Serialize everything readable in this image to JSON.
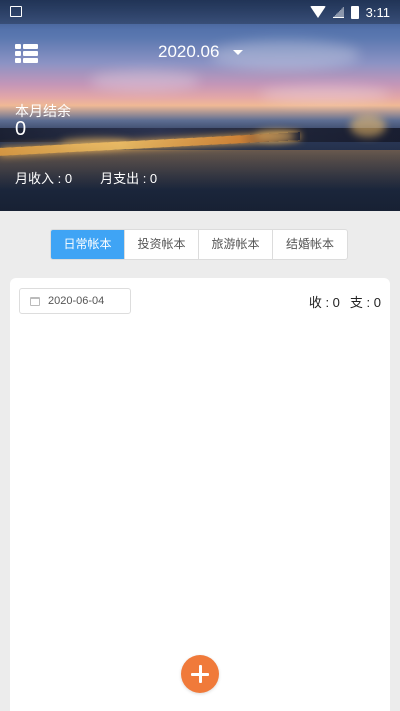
{
  "status_bar": {
    "time": "3:11",
    "icons": [
      "image-icon",
      "wifi-icon",
      "signal-icon",
      "battery-icon"
    ]
  },
  "header": {
    "menu_icon": "list-menu-icon",
    "month": "2020.06",
    "balance_label": "本月结余",
    "balance_value": "0",
    "income_label": "月收入 : 0",
    "expense_label": "月支出 : 0"
  },
  "tabs": [
    {
      "label": "日常帐本",
      "active": true
    },
    {
      "label": "投资帐本",
      "active": false
    },
    {
      "label": "旅游帐本",
      "active": false
    },
    {
      "label": "结婚帐本",
      "active": false
    }
  ],
  "card": {
    "date": "2020-06-04",
    "income": "收 : 0",
    "expense": "支 : 0"
  },
  "actions": {
    "add_icon": "plus-icon"
  },
  "colors": {
    "accent_tab": "#3fa4f5",
    "add_button": "#f07a3a",
    "background": "#ececec"
  }
}
